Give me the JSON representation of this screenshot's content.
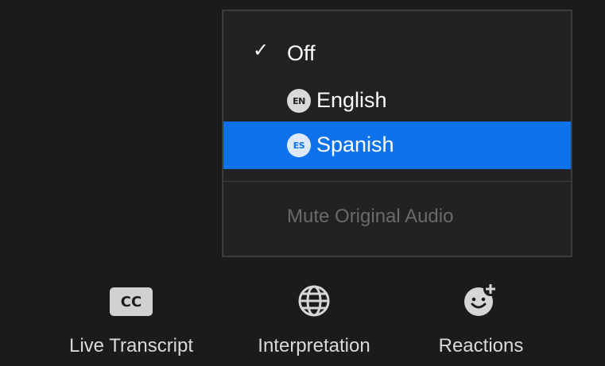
{
  "menu": {
    "items": [
      {
        "label": "Off",
        "checked": true,
        "selected": false
      },
      {
        "label": "English",
        "badge": "EN",
        "checked": false,
        "selected": false
      },
      {
        "label": "Spanish",
        "badge": "ES",
        "checked": false,
        "selected": true
      }
    ],
    "check_glyph": "✓",
    "mute_label": "Mute Original Audio",
    "highlight_color": "#0e72ed"
  },
  "toolbar": {
    "transcript": {
      "label": "Live Transcript",
      "icon_text": "CC",
      "icon": "cc-icon"
    },
    "interpretation": {
      "label": "Interpretation",
      "icon": "globe-icon"
    },
    "reactions": {
      "label": "Reactions",
      "icon": "smiley-plus-icon"
    }
  }
}
